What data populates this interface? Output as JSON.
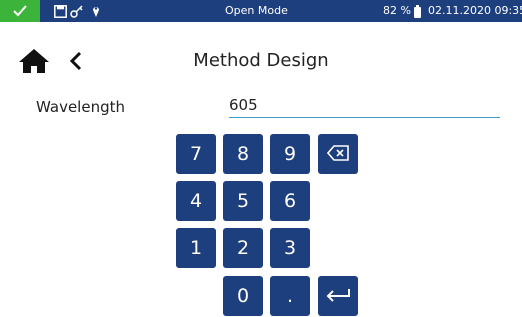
{
  "status": {
    "mode": "Open Mode",
    "battery": "82 %",
    "datetime": "02.11.2020 09:35",
    "status_color": "#3cb43c",
    "bar_color": "#1e3f7d",
    "icons": [
      "check-icon",
      "save-icon",
      "key-icon",
      "pin-icon",
      "battery-icon"
    ]
  },
  "header": {
    "title": "Method Design",
    "home_icon": "home-icon",
    "back_icon": "back-arrow-icon"
  },
  "field": {
    "label": "Wavelength",
    "value": "605"
  },
  "keypad": {
    "keys": [
      "7",
      "8",
      "9",
      "4",
      "5",
      "6",
      "1",
      "2",
      "3",
      "0",
      "."
    ],
    "backspace_icon": "backspace-icon",
    "enter_icon": "enter-icon",
    "key_color": "#1e3f7d"
  }
}
